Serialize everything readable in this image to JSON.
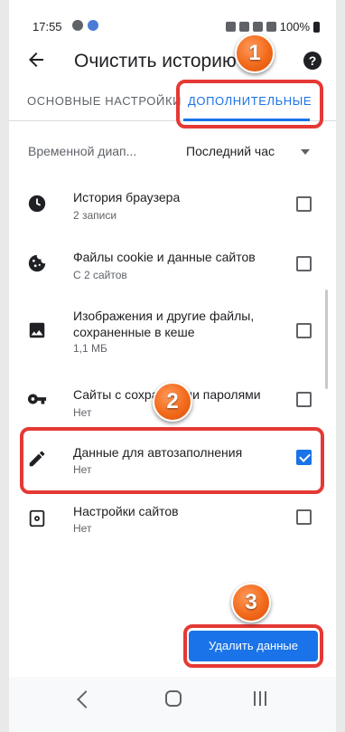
{
  "status_bar": {
    "time": "17:55",
    "battery": "100%",
    "icons": [
      "sim-icon",
      "app-icon",
      "alarm-icon",
      "mute-icon",
      "wifi-icon",
      "blocked-icon",
      "battery-icon"
    ]
  },
  "app_bar": {
    "title": "Очистить историю",
    "back_icon": "arrow-back-icon",
    "help_icon": "help-icon"
  },
  "tabs": [
    {
      "label": "ОСНОВНЫЕ НАСТРОЙКИ",
      "active": false
    },
    {
      "label": "ДОПОЛНИТЕЛЬНЫЕ",
      "active": true
    }
  ],
  "time_range": {
    "label": "Временной диап...",
    "value": "Последний час"
  },
  "items": [
    {
      "title": "История браузера",
      "subtitle": "2 записи",
      "icon": "clock-icon",
      "checked": false
    },
    {
      "title": "Файлы cookie и данные сайтов",
      "subtitle": "С 2 сайтов",
      "icon": "cookie-icon",
      "checked": false
    },
    {
      "title": "Изображения и другие файлы, сохраненные в кеше",
      "subtitle": "1,1 МБ",
      "icon": "image-icon",
      "checked": false
    },
    {
      "title": "Сайты с сохра… ыми паролями",
      "subtitle": "Нет",
      "icon": "key-icon",
      "checked": false
    },
    {
      "title": "Данные для автозаполнения",
      "subtitle": "Нет",
      "icon": "pencil-icon",
      "checked": true
    },
    {
      "title": "Настройки сайтов",
      "subtitle": "Нет",
      "icon": "site-settings-icon",
      "checked": false
    }
  ],
  "delete_button": {
    "label": "Удалить данные"
  },
  "annotations": {
    "badges": [
      "1",
      "2",
      "3"
    ],
    "highlight_color": "#e53935",
    "badge_color": "#f26a1b"
  },
  "colors": {
    "accent": "#1a73e8",
    "text_primary": "#202124",
    "text_secondary": "#5f6368"
  }
}
